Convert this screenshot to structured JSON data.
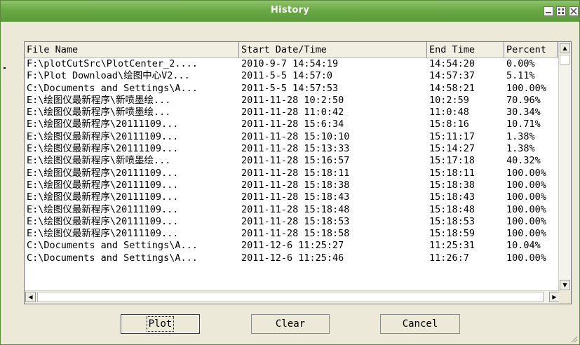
{
  "window": {
    "title": "History"
  },
  "columns": [
    "File Name",
    "Start Date/Time",
    "End Time",
    "Percent"
  ],
  "rows": [
    [
      "F:\\plotCutSrc\\PlotCenter_2....",
      "2010-9-7 14:54:19",
      "14:54:20",
      "0.00%"
    ],
    [
      "F:\\Plot Download\\绘图中心V2...",
      "2011-5-5 14:57:0",
      "14:57:37",
      "5.11%"
    ],
    [
      "C:\\Documents and Settings\\A...",
      "2011-5-5 14:57:53",
      "14:58:21",
      "100.00%"
    ],
    [
      "E:\\绘图仪最新程序\\新喷墨绘...",
      "2011-11-28 10:2:50",
      "10:2:59",
      "70.96%"
    ],
    [
      "E:\\绘图仪最新程序\\新喷墨绘...",
      "2011-11-28 11:0:42",
      "11:0:48",
      "30.34%"
    ],
    [
      "E:\\绘图仪最新程序\\20111109...",
      "2011-11-28 15:6:34",
      "15:8:16",
      "10.71%"
    ],
    [
      "E:\\绘图仪最新程序\\20111109...",
      "2011-11-28 15:10:10",
      "15:11:17",
      "1.38%"
    ],
    [
      "E:\\绘图仪最新程序\\20111109...",
      "2011-11-28 15:13:33",
      "15:14:27",
      "1.38%"
    ],
    [
      "E:\\绘图仪最新程序\\新喷墨绘...",
      "2011-11-28 15:16:57",
      "15:17:18",
      "40.32%"
    ],
    [
      "E:\\绘图仪最新程序\\20111109...",
      "2011-11-28 15:18:11",
      "15:18:11",
      "100.00%"
    ],
    [
      "E:\\绘图仪最新程序\\20111109...",
      "2011-11-28 15:18:38",
      "15:18:38",
      "100.00%"
    ],
    [
      "E:\\绘图仪最新程序\\20111109...",
      "2011-11-28 15:18:43",
      "15:18:43",
      "100.00%"
    ],
    [
      "E:\\绘图仪最新程序\\20111109...",
      "2011-11-28 15:18:48",
      "15:18:48",
      "100.00%"
    ],
    [
      "E:\\绘图仪最新程序\\20111109...",
      "2011-11-28 15:18:53",
      "15:18:53",
      "100.00%"
    ],
    [
      "E:\\绘图仪最新程序\\20111109...",
      "2011-11-28 15:18:58",
      "15:18:59",
      "100.00%"
    ],
    [
      "C:\\Documents and Settings\\A...",
      "2011-12-6 11:25:27",
      "11:25:31",
      "10.04%"
    ],
    [
      "C:\\Documents and Settings\\A...",
      "2011-12-6 11:25:46",
      "11:26:7",
      "100.00%"
    ]
  ],
  "buttons": {
    "plot": "Plot",
    "clear": "Clear",
    "cancel": "Cancel"
  },
  "icons": {
    "minimize": "minimize-icon",
    "maximize": "maximize-icon",
    "close": "close-icon",
    "scroll_up": "arrow-up-icon",
    "scroll_down": "arrow-down-icon",
    "scroll_left": "arrow-left-icon",
    "scroll_right": "arrow-right-icon"
  },
  "colors": {
    "titlebar": "#6aa845",
    "dialog": "#ece9d8"
  }
}
